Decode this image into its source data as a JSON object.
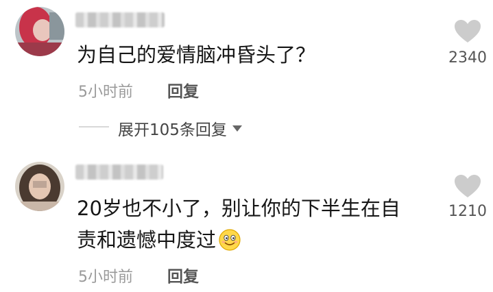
{
  "comments": [
    {
      "author": "",
      "text": "为自己的爱情脑冲昏头了？",
      "time": "5小时前",
      "reply_label": "回复",
      "likes": "2340",
      "expand_label": "展开105条回复",
      "avatar_icon": "avatar-icon"
    },
    {
      "author": "",
      "text_line1": "20岁也不小了，别让你的下半生在自",
      "text_line2": "责和遗憾中度过",
      "emoji": "smile-emoji",
      "time": "5小时前",
      "reply_label": "回复",
      "likes": "1210",
      "avatar_icon": "avatar-icon"
    }
  ],
  "colors": {
    "heart": "#cccccc",
    "muted_text": "#9a9a9a",
    "reply": "#555555"
  }
}
